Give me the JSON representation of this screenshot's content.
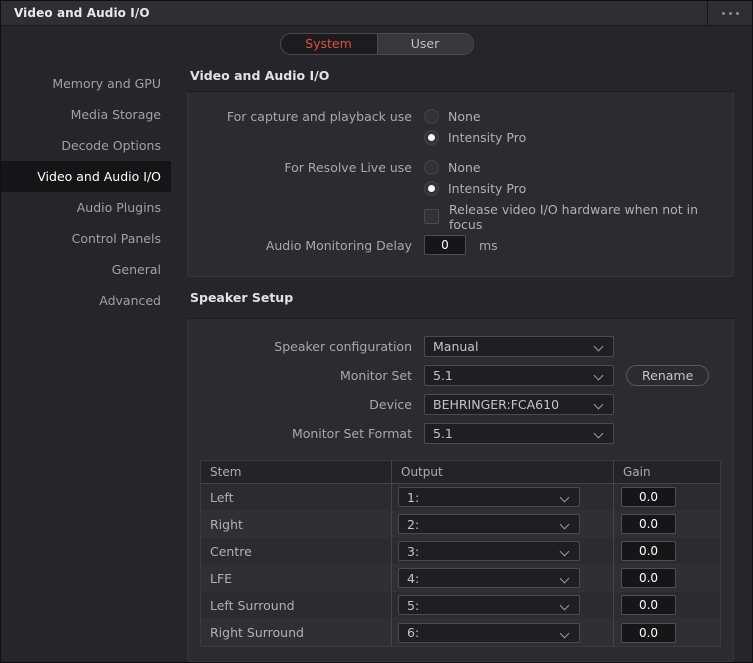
{
  "window": {
    "title": "Video and Audio I/O",
    "menu_icon": "kebab-menu-icon"
  },
  "tabs": {
    "system_label": "System",
    "user_label": "User",
    "active": "System",
    "active_color": "#e0503c"
  },
  "sidebar": {
    "items": [
      {
        "label": "Memory and GPU",
        "active": false
      },
      {
        "label": "Media Storage",
        "active": false
      },
      {
        "label": "Decode Options",
        "active": false
      },
      {
        "label": "Video and Audio I/O",
        "active": true
      },
      {
        "label": "Audio Plugins",
        "active": false
      },
      {
        "label": "Control Panels",
        "active": false
      },
      {
        "label": "General",
        "active": false
      },
      {
        "label": "Advanced",
        "active": false
      }
    ]
  },
  "io_section": {
    "title": "Video and Audio I/O",
    "capture": {
      "label": "For capture and playback use",
      "options": [
        {
          "label": "None",
          "selected": false
        },
        {
          "label": "Intensity Pro",
          "selected": true
        }
      ]
    },
    "resolve_live": {
      "label": "For Resolve Live use",
      "options": [
        {
          "label": "None",
          "selected": false
        },
        {
          "label": "Intensity Pro",
          "selected": true
        }
      ]
    },
    "release_hardware": {
      "label": "Release video I/O hardware when not in focus",
      "checked": false
    },
    "audio_delay": {
      "label": "Audio Monitoring Delay",
      "value": "0",
      "unit": "ms"
    }
  },
  "speaker_section": {
    "title": "Speaker Setup",
    "fields": [
      {
        "label": "Speaker configuration",
        "value": "Manual"
      },
      {
        "label": "Monitor Set",
        "value": "5.1"
      },
      {
        "label": "Device",
        "value": "BEHRINGER:FCA610"
      },
      {
        "label": "Monitor Set Format",
        "value": "5.1"
      }
    ],
    "rename_label": "Rename",
    "table": {
      "headers": [
        "Stem",
        "Output",
        "Gain"
      ],
      "rows": [
        {
          "stem": "Left",
          "output": "1:",
          "gain": "0.0"
        },
        {
          "stem": "Right",
          "output": "2:",
          "gain": "0.0"
        },
        {
          "stem": "Centre",
          "output": "3:",
          "gain": "0.0"
        },
        {
          "stem": "LFE",
          "output": "4:",
          "gain": "0.0"
        },
        {
          "stem": "Left Surround",
          "output": "5:",
          "gain": "0.0"
        },
        {
          "stem": "Right Surround",
          "output": "6:",
          "gain": "0.0"
        }
      ]
    }
  }
}
